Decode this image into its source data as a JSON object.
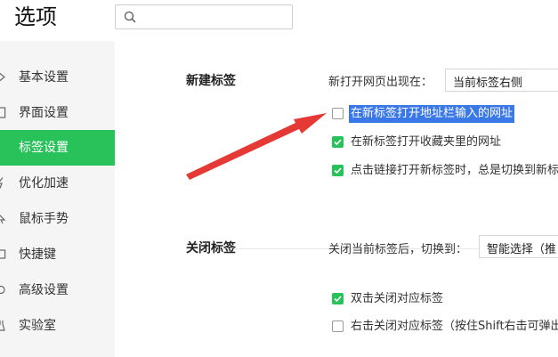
{
  "header": {
    "title": "选项",
    "search_placeholder": ""
  },
  "sidebar": {
    "items": [
      {
        "label": "基本设置"
      },
      {
        "label": "界面设置"
      },
      {
        "label": "标签设置",
        "active": true
      },
      {
        "label": "优化加速"
      },
      {
        "label": "鼠标手势"
      },
      {
        "label": "快捷键"
      },
      {
        "label": "高级设置"
      },
      {
        "label": "实验室"
      }
    ]
  },
  "new_tab": {
    "title": "新建标签",
    "open_position_label": "新打开网页出现在：",
    "open_position_value": "当前标签右侧",
    "options": [
      {
        "label": "在新标签打开地址栏输入的网址",
        "checked": false
      },
      {
        "label": "在新标签打开收藏夹里的网址",
        "checked": true
      },
      {
        "label": "点击链接打开新标签时，总是切换到新标",
        "checked": true
      }
    ]
  },
  "close_tab": {
    "title": "关闭标签",
    "switch_label": "关闭当前标签后，切换到：",
    "switch_value": "智能选择（推",
    "options": [
      {
        "label": "双击关闭对应标签",
        "checked": true
      },
      {
        "label": "右击关闭对应标签（按住Shift右击可弹出",
        "checked": false
      }
    ]
  },
  "colors": {
    "accent": "#29c25a",
    "annotation_arrow": "#e53935",
    "highlight": "#3b78e7"
  }
}
